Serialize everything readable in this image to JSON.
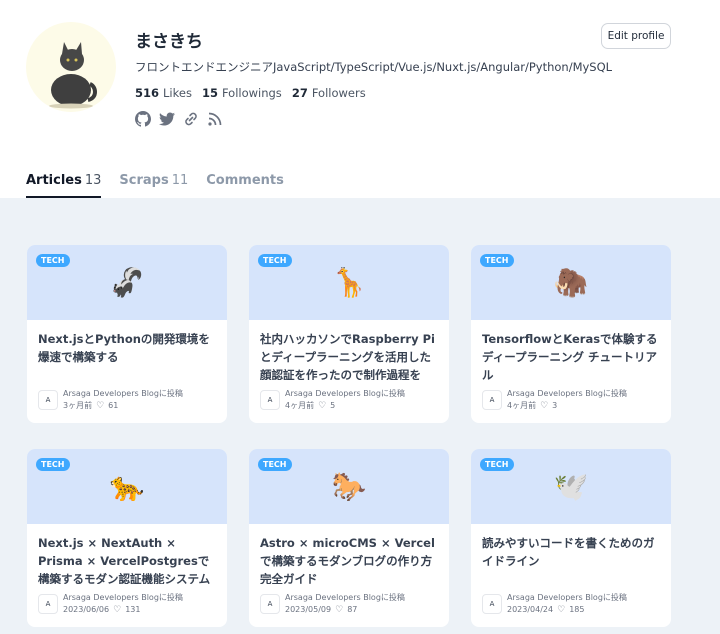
{
  "profile": {
    "name": "まさきち",
    "bio": "フロントエンドエンジニアJavaScript/TypeScript/Vue.js/Nuxt.js/Angular/Python/MySQL",
    "likes_count": "516",
    "likes_label": "Likes",
    "followings_count": "15",
    "followings_label": "Followings",
    "followers_count": "27",
    "followers_label": "Followers",
    "edit_label": "Edit profile"
  },
  "tabs": [
    {
      "label": "Articles",
      "count": "13"
    },
    {
      "label": "Scraps",
      "count": "11"
    },
    {
      "label": "Comments",
      "count": ""
    }
  ],
  "cards": [
    {
      "badge": "TECH",
      "emoji": "🦨",
      "title": "Next.jsとPythonの開発環境を爆速で構築する",
      "publication": "Arsaga Developers Blogに投稿",
      "date": "3ヶ月前",
      "likes": "61"
    },
    {
      "badge": "TECH",
      "emoji": "🦒",
      "title": "社内ハッカソンでRaspberry Piとディープラーニングを活用した顔認証を作ったので制作過程を共…",
      "publication": "Arsaga Developers Blogに投稿",
      "date": "4ヶ月前",
      "likes": "5"
    },
    {
      "badge": "TECH",
      "emoji": "🦣",
      "title": "TensorflowとKerasで体験するディープラーニング チュートリアル",
      "publication": "Arsaga Developers Blogに投稿",
      "date": "4ヶ月前",
      "likes": "3"
    },
    {
      "badge": "TECH",
      "emoji": "🐆",
      "title": "Next.js × NextAuth × Prisma × VercelPostgresで構築するモダン認証機能システム",
      "publication": "Arsaga Developers Blogに投稿",
      "date": "2023/06/06",
      "likes": "131"
    },
    {
      "badge": "TECH",
      "emoji": "🐎",
      "title": "Astro × microCMS × Vercelで構築するモダンブログの作り方 完全ガイド",
      "publication": "Arsaga Developers Blogに投稿",
      "date": "2023/05/09",
      "likes": "87"
    },
    {
      "badge": "TECH",
      "emoji": "🕊️",
      "title": "読みやすいコードを書くためのガイドライン",
      "publication": "Arsaga Developers Blogに投稿",
      "date": "2023/04/24",
      "likes": "185"
    }
  ],
  "icons": {
    "social": [
      "github-icon",
      "twitter-icon",
      "link-icon",
      "rss-icon"
    ],
    "like": "heart-icon"
  },
  "colors": {
    "accent": "#3ea8ff",
    "card_top": "#d6e4fb",
    "feed_bg": "#edf2f7"
  }
}
